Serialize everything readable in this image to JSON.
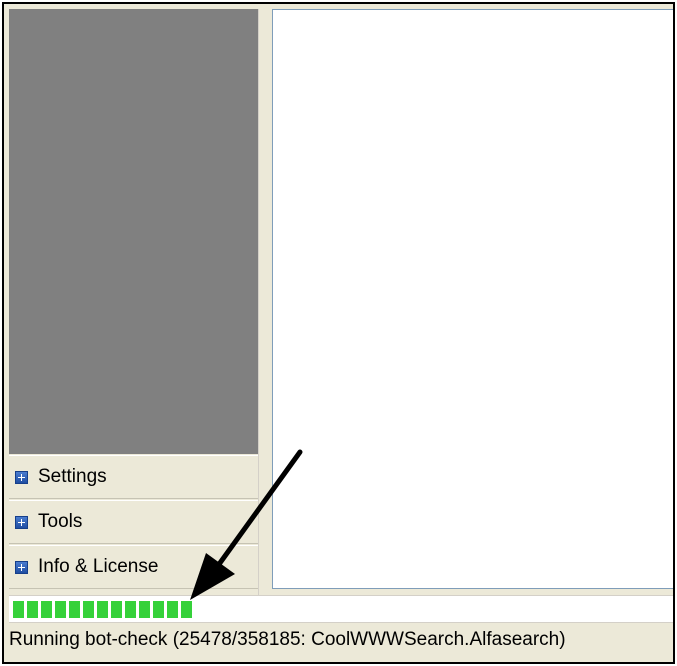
{
  "sidebar": {
    "items": [
      {
        "label": "Settings",
        "icon": "expand-plus-icon"
      },
      {
        "label": "Tools",
        "icon": "expand-plus-icon"
      },
      {
        "label": "Info & License",
        "icon": "expand-plus-icon"
      }
    ]
  },
  "progress": {
    "segments": 13,
    "fraction": 0.28,
    "color": "#35d13a"
  },
  "status": {
    "text": "Running bot-check (25478/358185: CoolWWWSearch.Alfasearch)"
  },
  "annotation": {
    "arrow_color": "#000000"
  }
}
